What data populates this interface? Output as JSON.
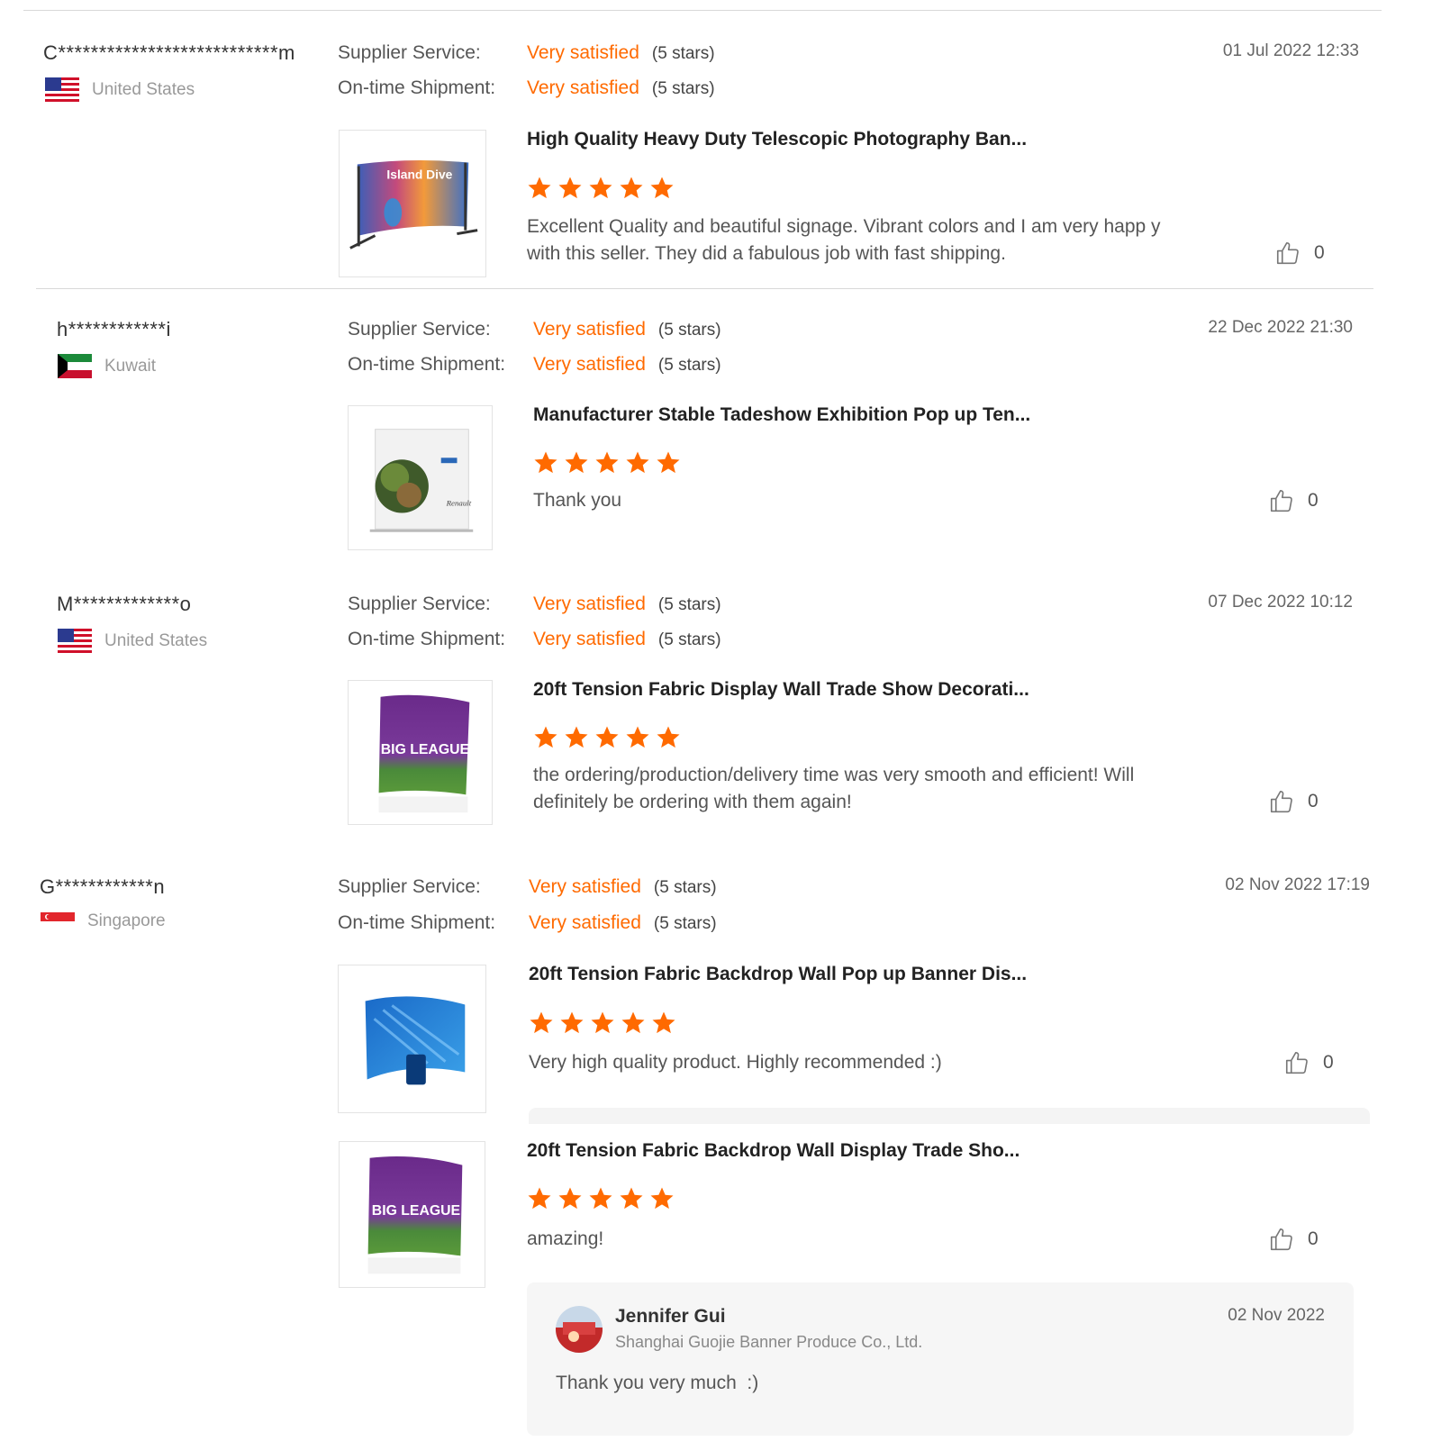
{
  "labels": {
    "supplier_service": "Supplier Service:",
    "ontime_shipment": "On-time Shipment:",
    "satisfaction": "Very satisfied",
    "stars_note": "(5 stars)"
  },
  "reviews": [
    {
      "user": "C***************************m",
      "country": "United States",
      "flag": "us-flag-icon",
      "date": "01 Jul 2022 12:33",
      "items": [
        {
          "product": "High Quality Heavy Duty Telescopic Photography Ban...",
          "text": "Excellent Quality and beautiful signage. Vibrant colors and I am very happ y with this seller. They did a fabulous job with fast shipping.",
          "likes": "0",
          "rating": 5,
          "image_text": "Island Dive"
        }
      ]
    },
    {
      "user": "h************i",
      "country": "Kuwait",
      "flag": "kuwait-flag-icon",
      "date": "22 Dec 2022 21:30",
      "items": [
        {
          "product": "Manufacturer Stable Tadeshow Exhibition Pop up Ten...",
          "text": "Thank you",
          "likes": "0",
          "rating": 5
        }
      ]
    },
    {
      "user": "M*************o",
      "country": "United States",
      "flag": "us-flag-icon",
      "date": "07 Dec 2022 10:12",
      "items": [
        {
          "product": "20ft Tension Fabric Display Wall Trade Show Decorati...",
          "text": "the ordering/production/delivery time was very smooth and efficient! Will definitely be ordering with them again!",
          "likes": "0",
          "rating": 5,
          "image_text": "BIG LEAGUE"
        }
      ]
    },
    {
      "user": "G************n",
      "country": "Singapore",
      "flag": "singapore-flag-icon",
      "date": "02 Nov 2022 17:19",
      "items": [
        {
          "product": "20ft Tension Fabric Backdrop Wall Pop up Banner Dis...",
          "text": "Very high quality product. Highly recommended :)",
          "likes": "0",
          "rating": 5
        },
        {
          "product": "20ft Tension Fabric Backdrop Wall Display Trade Sho...",
          "text": "amazing!",
          "likes": "0",
          "rating": 5,
          "image_text": "BIG LEAGUE"
        }
      ],
      "reply": {
        "name": "Jennifer Gui",
        "company": "Shanghai Guojie Banner Produce Co., Ltd.",
        "date": "02 Nov 2022",
        "text": "Thank you very much  :)"
      }
    }
  ],
  "colors": {
    "accent": "#ff6a00",
    "divider": "#d8d8d8"
  }
}
